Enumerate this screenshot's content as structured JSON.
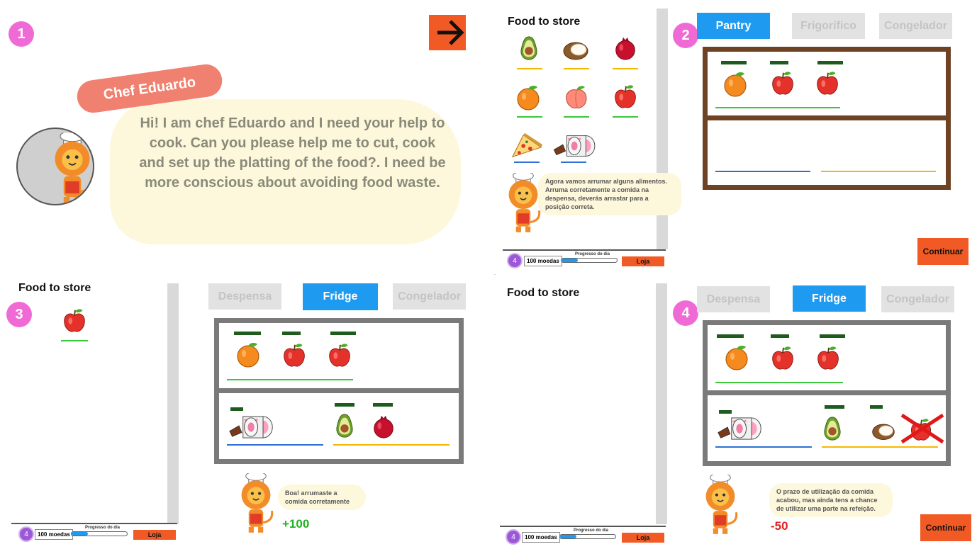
{
  "steps": [
    "1",
    "2",
    "3",
    "4"
  ],
  "intro": {
    "chef_name": "Chef Eduardo",
    "message": "Hi! I am chef Eduardo and I need your help to cook. Can you please help me to cut, cook and set up the platting of the food?. I need be more conscious about avoiding food waste."
  },
  "food_to_store_title": "Food to store",
  "tabs_step2": [
    "Pantry",
    "Frigorífico",
    "Congelador"
  ],
  "tabs_step3": [
    "Despensa",
    "Fridge",
    "Congelador"
  ],
  "tabs_step4": [
    "Despensa",
    "Fridge",
    "Congelador"
  ],
  "step2_message": "Agora vamos arrumar alguns alimentos. Arruma corretamente a comida na despensa, deverás arrastar para a posição correta.",
  "step3_message": "Boa! arrumaste a comida corretamente",
  "step4_message": "O prazo de utilização da comida acabou, mas ainda tens a chance de utilizar uma parte na refeição.",
  "score_gain": "+100",
  "score_loss": "-50",
  "continue_label": "Continuar",
  "status": {
    "coins": "100 moedas",
    "progress_label": "Progresso do dia",
    "progress": 0.3,
    "shop_label": "Loja",
    "coin_icon": "4"
  },
  "colors": {
    "accent_orange": "#f15a24",
    "active_tab": "#1e9bf0",
    "step_badge": "#f06ad6",
    "shelf_green": "#3ac83a",
    "shelf_blue": "#2e6fd6",
    "shelf_yellow": "#f5b800"
  },
  "icons": [
    "arrow-right-icon",
    "avocado-icon",
    "coconut-icon",
    "pomegranate-icon",
    "orange-icon",
    "peach-icon",
    "apple-icon",
    "pizza-icon",
    "sushi-roll-icon",
    "chef-lion-icon",
    "cross-icon"
  ]
}
